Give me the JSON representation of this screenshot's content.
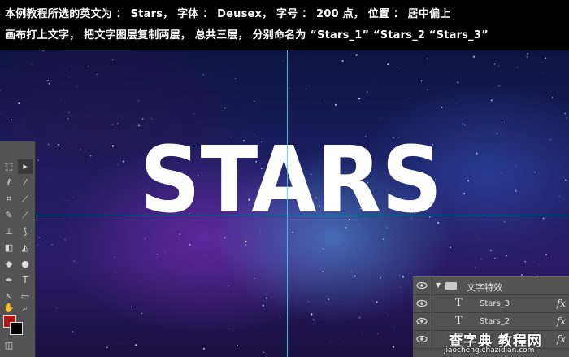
{
  "instructions": {
    "line1": "本例教程所选的英文为 ： Stars， 字体 ： Deusex， 字号 ： 200 点， 位置 ： 居中偏上",
    "line2": "画布打上文字， 把文字图层复制两层， 总共三层， 分别命名为 “Stars_1” “Stars_2 “Stars_3”"
  },
  "canvas": {
    "headline": "STARS",
    "guide_color": "#33ddee"
  },
  "toolbox": {
    "foreground_color": "#b01818",
    "background_color": "#000000",
    "tools": [
      "marquee-icon",
      "move-icon",
      "lasso-icon",
      "magic-wand-icon",
      "crop-icon",
      "eyedropper-icon",
      "healing-icon",
      "brush-icon",
      "stamp-icon",
      "history-brush-icon",
      "eraser-icon",
      "paint-bucket-icon",
      "blur-icon",
      "dodge-icon",
      "pen-icon",
      "type-icon",
      "path-select-icon",
      "shape-icon",
      "hand-icon",
      "zoom-icon"
    ]
  },
  "layers_panel": {
    "group_name": "文字特效",
    "layers": [
      {
        "name": "Stars_3",
        "type_glyph": "T",
        "fx": "fx"
      },
      {
        "name": "Stars_2",
        "type_glyph": "T",
        "fx": "fx"
      },
      {
        "name": "",
        "type_glyph": "T",
        "fx": "fx"
      }
    ]
  },
  "watermark": {
    "main": "查字典 教程网",
    "sub": "jiaocheng.chazidian.com"
  }
}
